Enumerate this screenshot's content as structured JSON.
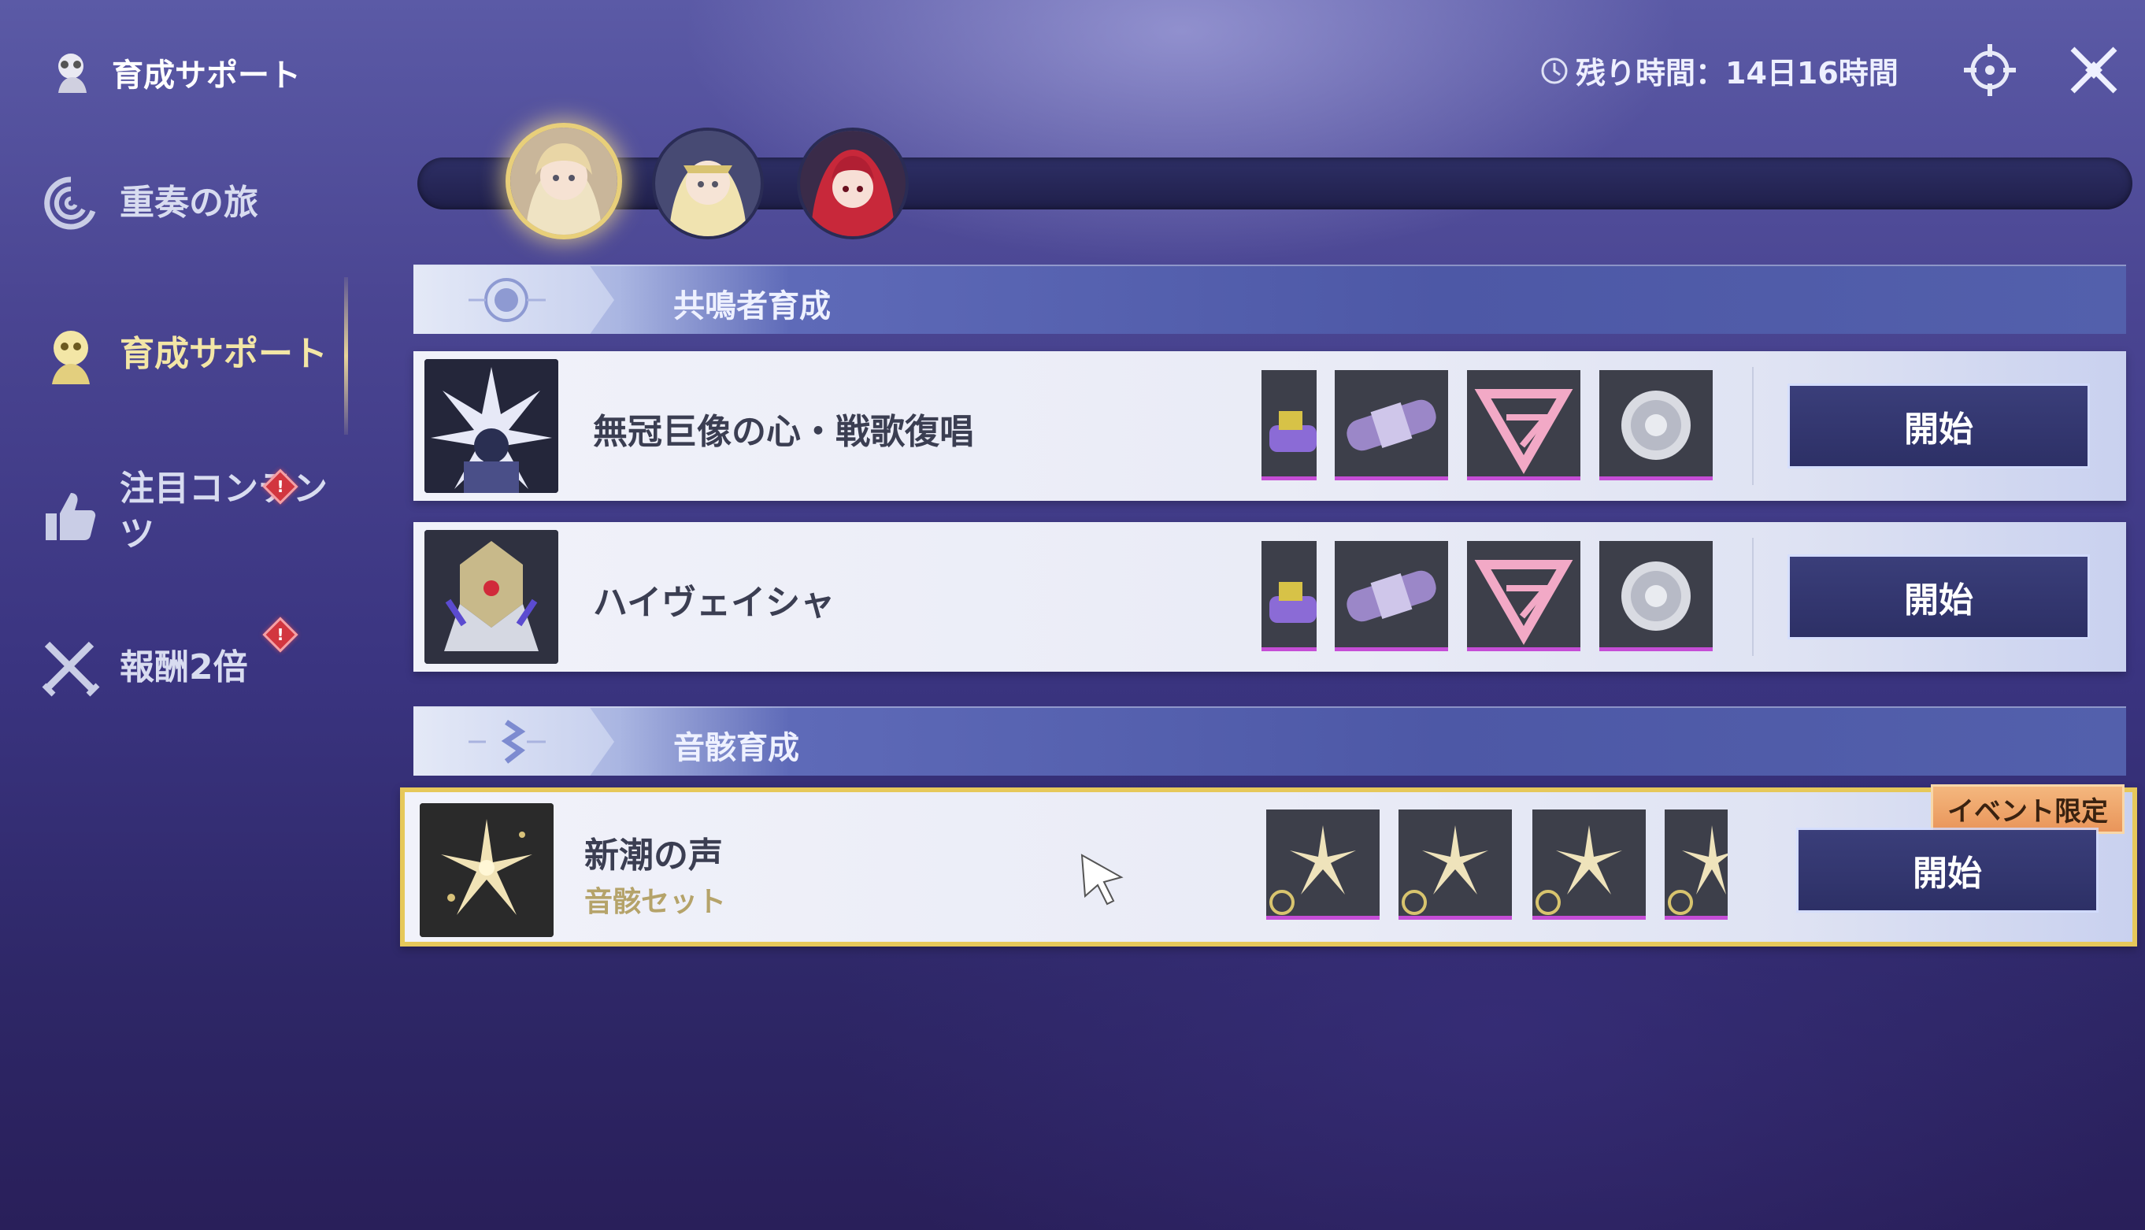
{
  "header": {
    "title": "育成サポート",
    "timer_label": "残り時間：14日16時間"
  },
  "sidebar": {
    "items": [
      {
        "label": "重奏の旅",
        "icon": "swirl-icon",
        "active": false
      },
      {
        "label": "育成サポート",
        "icon": "character-support-icon",
        "active": true
      },
      {
        "label": "注目コンテンツ",
        "icon": "thumbs-up-icon",
        "active": false,
        "badge": "!"
      },
      {
        "label": "報酬2倍",
        "icon": "crossed-swords-icon",
        "active": false,
        "badge": "!"
      }
    ]
  },
  "characters": [
    {
      "name": "avatar-blonde-halo",
      "selected": true
    },
    {
      "name": "avatar-blonde-crown",
      "selected": false
    },
    {
      "name": "avatar-red-hair",
      "selected": false
    }
  ],
  "sections": [
    {
      "title": "共鳴者育成",
      "rows": [
        {
          "name": "無冠巨像の心・戦歌復唱",
          "materials": [
            "partial-material",
            "purple-capsule",
            "pink-sigil",
            "silver-core"
          ],
          "button": "開始"
        },
        {
          "name": "ハイヴェイシャ",
          "materials": [
            "partial-material",
            "purple-capsule",
            "pink-sigil",
            "silver-core"
          ],
          "button": "開始"
        }
      ]
    },
    {
      "title": "音骸育成",
      "rows": [
        {
          "name": "新潮の声",
          "subtitle": "音骸セット",
          "tag": "イベント限定",
          "materials": [
            "echo-star",
            "echo-star",
            "echo-star",
            "echo-star-partial"
          ],
          "button": "開始"
        }
      ]
    }
  ],
  "colors": {
    "accent_gold": "#e6c85a",
    "button_bg": "#2d3066",
    "badge_red": "#d2363f"
  }
}
